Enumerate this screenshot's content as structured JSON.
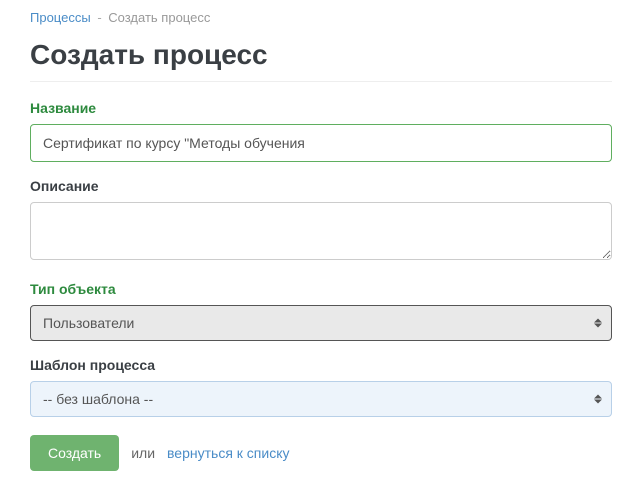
{
  "breadcrumb": {
    "root_label": "Процессы",
    "current_label": "Создать процесс"
  },
  "page_title": "Создать процесс",
  "form": {
    "name": {
      "label": "Название",
      "value": "Сертификат по курсу \"Методы обучения"
    },
    "description": {
      "label": "Описание",
      "value": ""
    },
    "object_type": {
      "label": "Тип объекта",
      "selected": "Пользователи"
    },
    "template": {
      "label": "Шаблон процесса",
      "selected": "-- без шаблона --"
    }
  },
  "actions": {
    "submit_label": "Создать",
    "or_text": "или",
    "back_label": "вернуться к списку"
  }
}
